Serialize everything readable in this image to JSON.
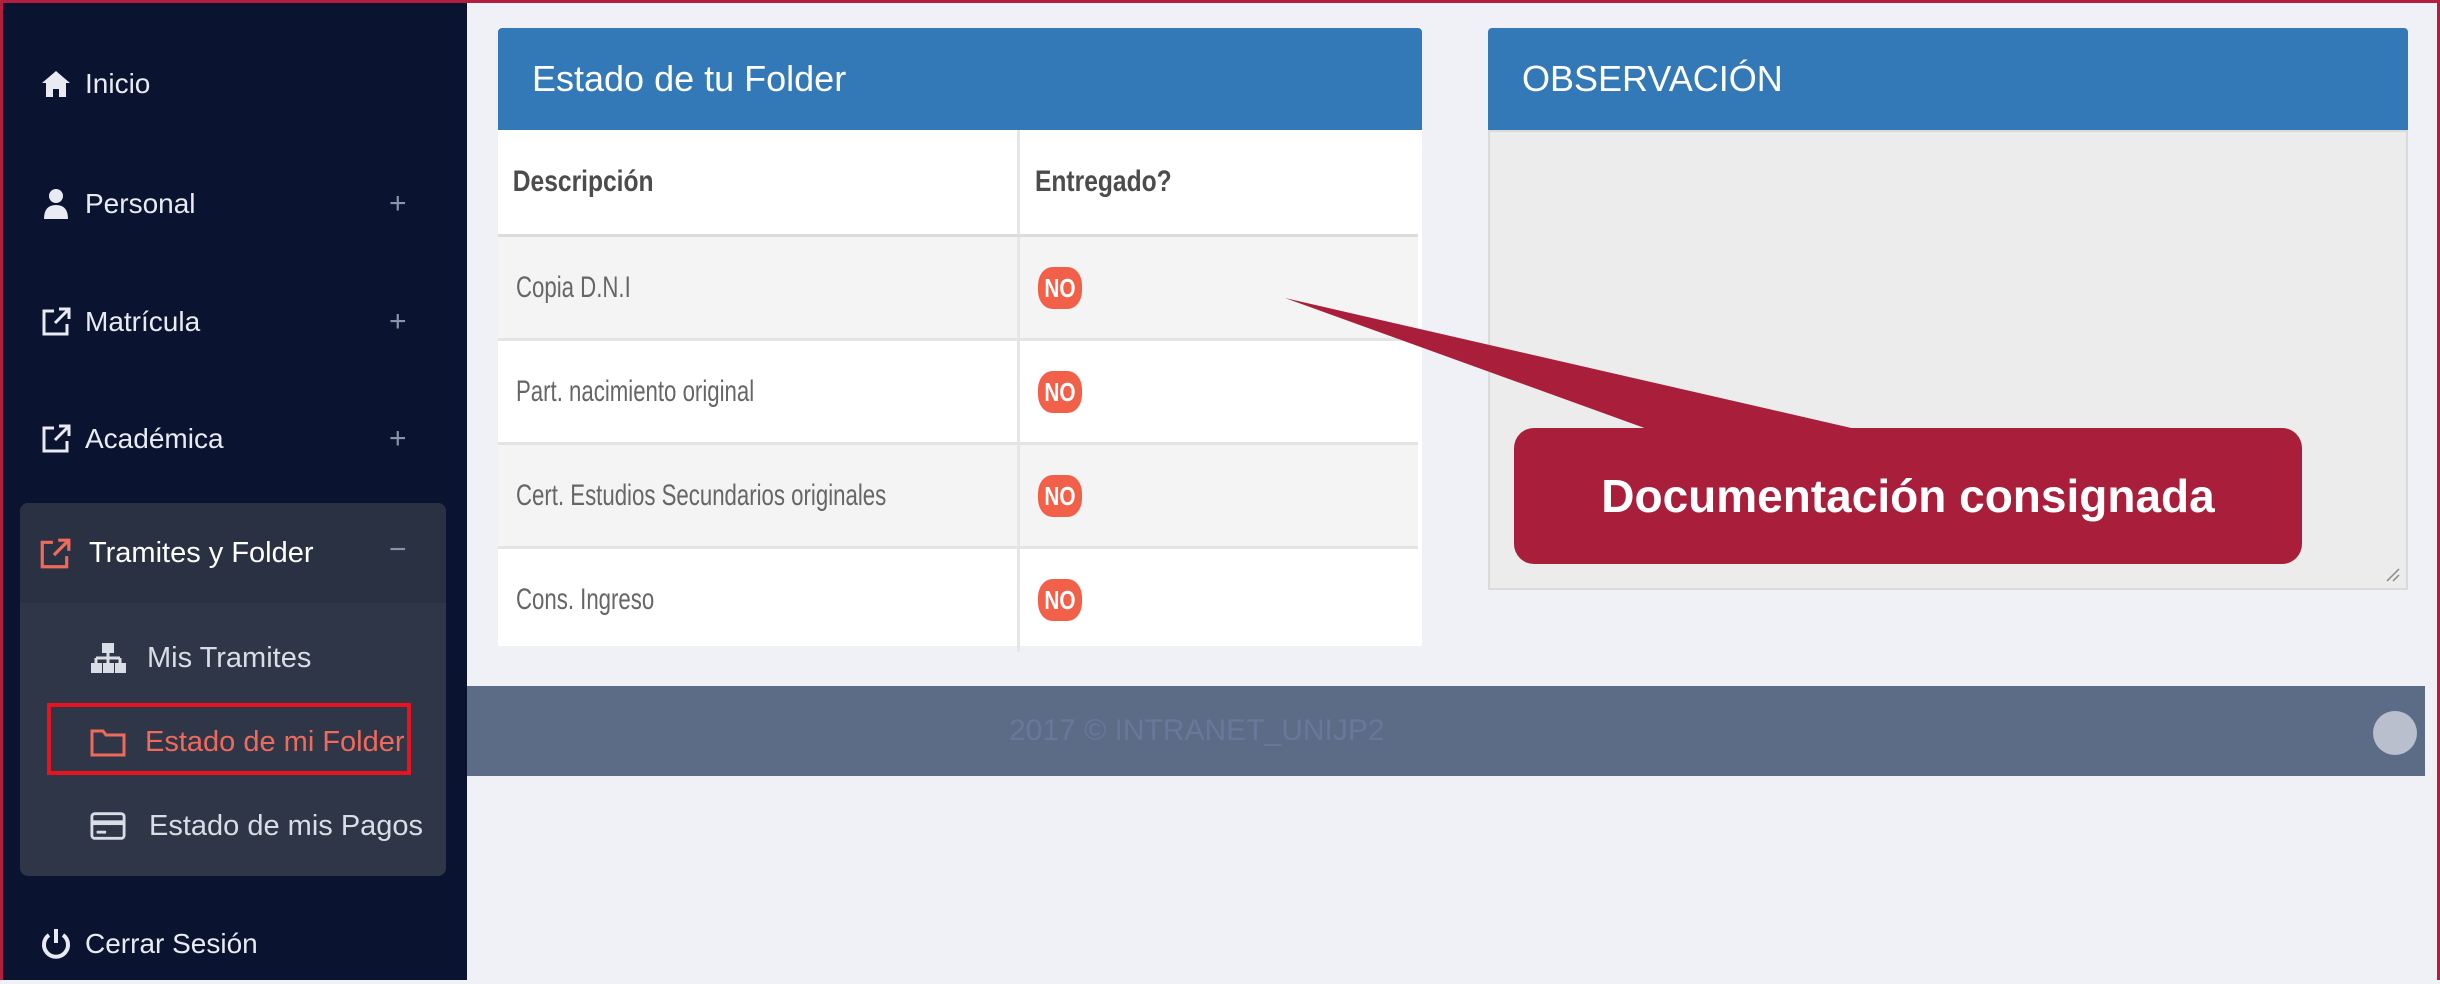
{
  "sidebar": {
    "items": [
      {
        "label": "Inicio",
        "icon": "home-icon"
      },
      {
        "label": "Personal",
        "toggle": "+",
        "icon": "user-icon"
      },
      {
        "label": "Matrícula",
        "toggle": "+",
        "icon": "external-link-icon"
      },
      {
        "label": "Académica",
        "toggle": "+",
        "icon": "external-link-icon"
      },
      {
        "label": "Tramites y Folder",
        "toggle": "−",
        "icon": "external-link-icon"
      },
      {
        "label": "Cerrar Sesión",
        "icon": "power-icon"
      }
    ],
    "subitems": [
      {
        "label": "Mis Tramites",
        "icon": "sitemap-icon"
      },
      {
        "label": "Estado de mi Folder",
        "icon": "folder-icon"
      },
      {
        "label": "Estado de mis Pagos",
        "icon": "credit-card-icon"
      }
    ]
  },
  "folder": {
    "title": "Estado de tu Folder",
    "columns": [
      "Descripción",
      "Entregado?"
    ],
    "rows": [
      {
        "desc": "Copia D.N.I",
        "status": "NO"
      },
      {
        "desc": "Part. nacimiento original",
        "status": "NO"
      },
      {
        "desc": "Cert. Estudios Secundarios originales",
        "status": "NO"
      },
      {
        "desc": "Cons. Ingreso",
        "status": "NO"
      }
    ]
  },
  "observation": {
    "title": "OBSERVACIÓN"
  },
  "footer": {
    "text": "2017 © INTRANET_UNIJP2"
  },
  "callout": {
    "text": "Documentación consignada"
  },
  "colors": {
    "sidebar_bg": "#0a1330",
    "panel_header": "#3479b7",
    "badge": "#f3604a",
    "active_accent": "#f06a5c",
    "callout": "#a91e3b",
    "highlight_border": "#e8131f"
  }
}
